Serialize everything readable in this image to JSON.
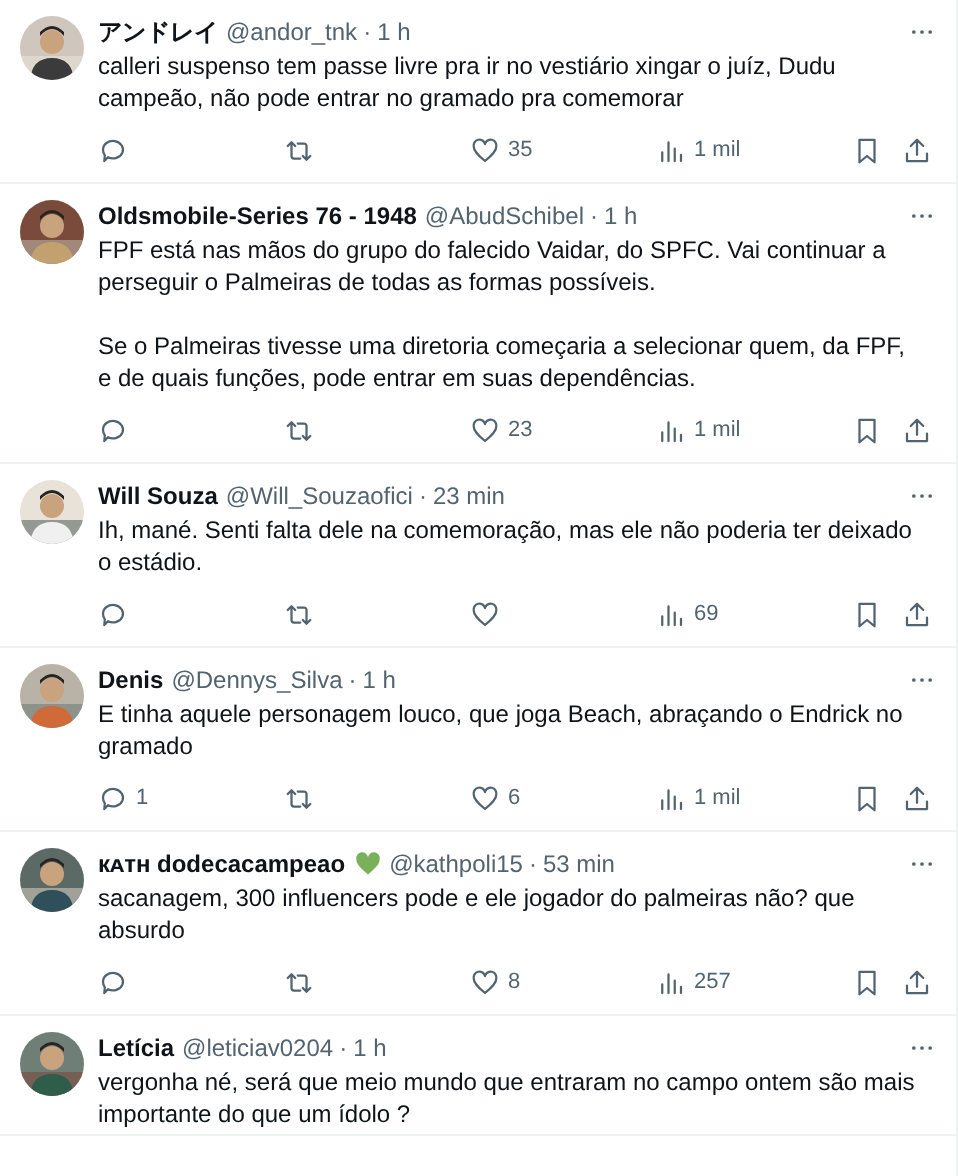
{
  "tweets": [
    {
      "name": "アンドレイ",
      "handle": "@andor_tnk",
      "separator": "·",
      "time": "1 h",
      "paragraphs": [
        "calleri suspenso tem passe livre pra ir no vestiário xingar o juíz, Dudu campeão, não pode entrar no gramado pra comemorar"
      ],
      "actions": {
        "likes": "35",
        "views": "1 mil"
      }
    },
    {
      "name": "Oldsmobile-Series 76 - 1948",
      "handle": "@AbudSchibel",
      "separator": "·",
      "time": "1 h",
      "paragraphs": [
        "FPF está nas mãos do grupo do falecido Vaidar, do SPFC. Vai continuar a perseguir o Palmeiras de todas as formas possíveis.",
        "Se o Palmeiras tivesse uma diretoria começaria a selecionar quem, da FPF, e de quais funções, pode entrar em suas dependências."
      ],
      "actions": {
        "likes": "23",
        "views": "1 mil"
      }
    },
    {
      "name": "Will Souza",
      "handle": "@Will_Souzaofici",
      "separator": "·",
      "time": "23 min",
      "paragraphs": [
        "Ih, mané. Senti falta dele na comemoração, mas ele não poderia ter deixado o estádio."
      ],
      "actions": {
        "views": "69"
      }
    },
    {
      "name": "Denis",
      "handle": "@Dennys_Silva",
      "separator": "·",
      "time": "1 h",
      "paragraphs": [
        "E tinha aquele personagem louco, que joga Beach, abraçando o Endrick no gramado"
      ],
      "actions": {
        "replies": "1",
        "likes": "6",
        "views": "1 mil"
      }
    },
    {
      "name": "кᴀᴛʜ dodecacampeao",
      "handle": "@kathpoli15",
      "separator": "·",
      "time": "53 min",
      "heart_badge": true,
      "paragraphs": [
        "sacanagem, 300 influencers pode e ele jogador do palmeiras não? que absurdo"
      ],
      "actions": {
        "likes": "8",
        "views": "257"
      }
    },
    {
      "name": "Letícia",
      "handle": "@leticiav0204",
      "separator": "·",
      "time": "1 h",
      "paragraphs": [
        "vergonha né, será que meio mundo que entraram no campo ontem são mais importante do que um ídolo ?"
      ]
    }
  ]
}
